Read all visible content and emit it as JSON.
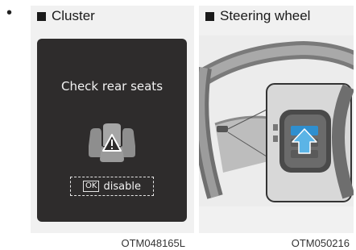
{
  "bullet": "•",
  "cluster": {
    "heading": "Cluster",
    "message": "Check rear seats",
    "ok_key": "OK",
    "action_label": "disable",
    "figure_code": "OTM048165L"
  },
  "steering": {
    "heading": "Steering wheel",
    "figure_code": "OTM050216"
  },
  "colors": {
    "display_bg": "#2e2c2c",
    "button_highlight": "#2f8fcf",
    "arrow": "#5bb4e6"
  },
  "icons": {
    "seat_warning": "rear-seat-warning-icon",
    "arrow": "arrow-up-icon"
  }
}
